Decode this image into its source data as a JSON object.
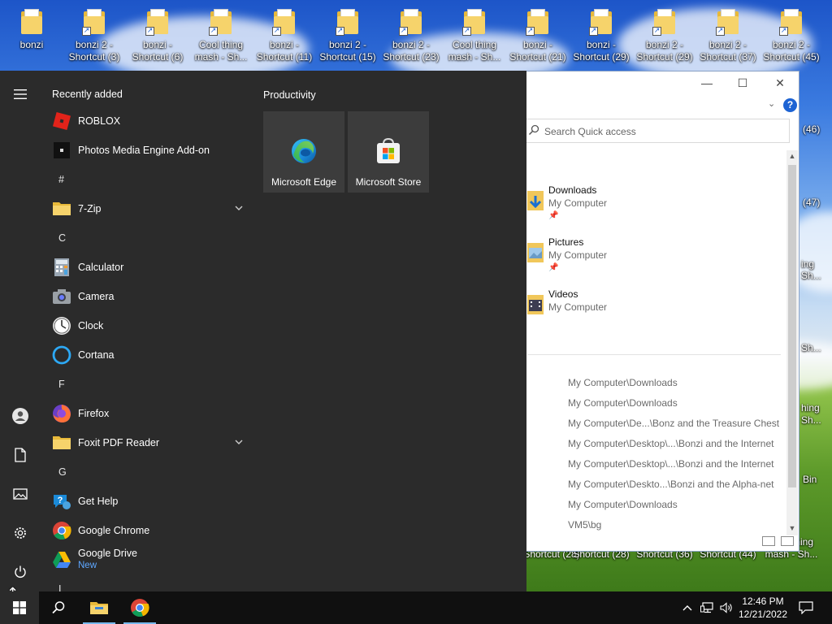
{
  "desktop": {
    "icons": [
      {
        "label": "bonzi",
        "icon": "folder-icon"
      },
      {
        "label": "bonzi 2 - Shortcut (3)",
        "icon": "folder-shortcut-icon"
      },
      {
        "label": "bonzi - Shortcut (6)",
        "icon": "folder-shortcut-icon"
      },
      {
        "label": "Cool thing mash - Sh...",
        "icon": "folder-shortcut-icon"
      },
      {
        "label": "bonzi - Shortcut (11)",
        "icon": "folder-shortcut-icon"
      },
      {
        "label": "bonzi 2 - Shortcut (15)",
        "icon": "folder-shortcut-icon"
      },
      {
        "label": "bonzi 2 - Shortcut (23)",
        "icon": "folder-shortcut-icon"
      },
      {
        "label": "Cool thing mash - Sh...",
        "icon": "folder-shortcut-icon"
      },
      {
        "label": "bonzi - Shortcut (21)",
        "icon": "folder-shortcut-icon"
      },
      {
        "label": "bonzi - Shortcut (29)",
        "icon": "folder-shortcut-icon"
      },
      {
        "label": "bonzi 2 - Shortcut (29)",
        "icon": "folder-shortcut-icon"
      },
      {
        "label": "bonzi 2 - Shortcut (37)",
        "icon": "folder-shortcut-icon"
      },
      {
        "label": "bonzi 2 - Shortcut (45)",
        "icon": "folder-shortcut-icon"
      }
    ],
    "bottom_labels": [
      "bonzi - Shortcut (28)",
      "bonzi 2 - Shortcut (28)",
      "bonzi 2 - Shortcut (36)",
      "bonzi - Shortcut (44)",
      "Cool thing mash - Sh..."
    ],
    "right_labels": [
      "(46)",
      "(47)",
      "ing",
      "Sh...",
      "Sh...",
      "hing",
      "Sh...",
      "Bin"
    ]
  },
  "explorer": {
    "search_placeholder": "Search Quick access",
    "quick_access": [
      {
        "name": "Downloads",
        "location": "My Computer",
        "icon": "downloads-folder-icon",
        "pinned": true
      },
      {
        "name": "Pictures",
        "location": "My Computer",
        "icon": "pictures-folder-icon",
        "pinned": true
      },
      {
        "name": "Videos",
        "location": "My Computer",
        "icon": "videos-folder-icon",
        "pinned": false
      }
    ],
    "pin_glyph": "📌",
    "recent_paths": [
      "My Computer\\Downloads",
      "My Computer\\Downloads",
      "My Computer\\De...\\Bonz and the Treasure Chest",
      "My Computer\\Desktop\\...\\Bonzi and the Internet",
      "My Computer\\Desktop\\...\\Bonzi and the Internet",
      "My Computer\\Deskto...\\Bonzi and the Alpha-net",
      "My Computer\\Downloads",
      "VM5\\bg"
    ],
    "help_label": "?"
  },
  "start_menu": {
    "recently_added_label": "Recently added",
    "productivity_label": "Productivity",
    "apps": [
      {
        "type": "app",
        "label": "ROBLOX",
        "icon": "roblox-icon"
      },
      {
        "type": "app",
        "label": "Photos Media Engine Add-on",
        "icon": "photos-addon-icon"
      },
      {
        "type": "letter",
        "label": "#"
      },
      {
        "type": "app",
        "label": "7-Zip",
        "icon": "folder-icon",
        "expandable": true
      },
      {
        "type": "letter",
        "label": "C"
      },
      {
        "type": "app",
        "label": "Calculator",
        "icon": "calculator-icon"
      },
      {
        "type": "app",
        "label": "Camera",
        "icon": "camera-icon"
      },
      {
        "type": "app",
        "label": "Clock",
        "icon": "clock-icon"
      },
      {
        "type": "app",
        "label": "Cortana",
        "icon": "cortana-icon"
      },
      {
        "type": "letter",
        "label": "F"
      },
      {
        "type": "app",
        "label": "Firefox",
        "icon": "firefox-icon"
      },
      {
        "type": "app",
        "label": "Foxit PDF Reader",
        "icon": "folder-icon",
        "expandable": true
      },
      {
        "type": "letter",
        "label": "G"
      },
      {
        "type": "app",
        "label": "Get Help",
        "icon": "get-help-icon"
      },
      {
        "type": "app",
        "label": "Google Chrome",
        "icon": "chrome-icon"
      },
      {
        "type": "app",
        "label": "Google Drive",
        "icon": "google-drive-icon",
        "sublabel": "New"
      },
      {
        "type": "letter",
        "label": "I"
      }
    ],
    "tiles": [
      {
        "label": "Microsoft Edge",
        "icon": "edge-icon"
      },
      {
        "label": "Microsoft Store",
        "icon": "store-icon"
      }
    ],
    "rail": [
      "hamburger-icon",
      "user-icon",
      "documents-icon",
      "pictures-icon",
      "settings-icon",
      "power-icon"
    ]
  },
  "taskbar": {
    "time": "12:46 PM",
    "date": "12/21/2022",
    "pinned": [
      "file-explorer-icon",
      "chrome-icon"
    ]
  },
  "colors": {
    "start_bg": "#2b2b2b",
    "taskbar_bg": "#101010",
    "accent": "#1d63d3",
    "new_badge": "#5ea7ff"
  }
}
